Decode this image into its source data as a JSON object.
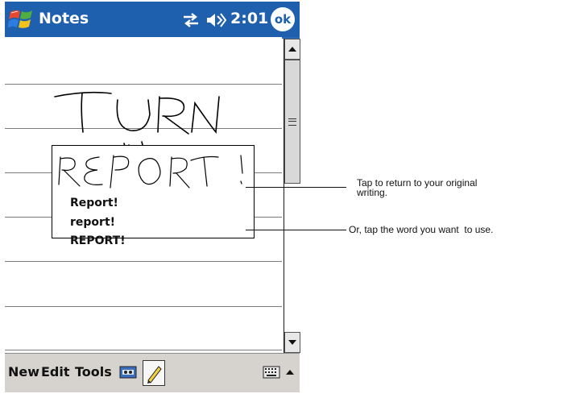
{
  "title_bar": {
    "app_title": "Notes",
    "clock": "2:01",
    "ok_label": "ok",
    "icons": [
      "start-menu-icon",
      "connectivity-icon",
      "volume-icon"
    ]
  },
  "note": {
    "handwritten_text": "TURN"
  },
  "popup": {
    "handwritten_text": "REPORT!",
    "suggestions": [
      "Report!",
      "report!",
      "REPORT!"
    ]
  },
  "menu_bar": {
    "items": [
      "New",
      "Edit",
      "Tools"
    ],
    "icons": [
      "recorder-icon",
      "pen-icon",
      "keyboard-icon",
      "input-panel-arrow-icon"
    ]
  },
  "callouts": [
    "Tap to return to your original writing.",
    "Or, tap the word you want  to use."
  ],
  "callouts_display": {
    "first_line1": "Tap to return to your original",
    "first_line2": "writing."
  },
  "colors": {
    "title_bar": "#1e5fae",
    "menu_bar": "#d6d3ce",
    "ink": "#000000"
  }
}
